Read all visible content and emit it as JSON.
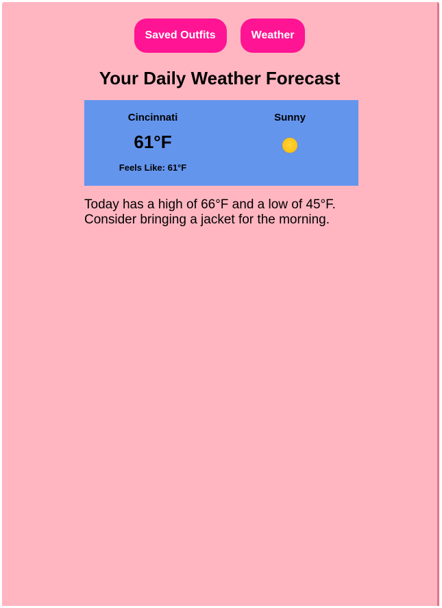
{
  "nav": {
    "saved_outfits_label": "Saved Outfits",
    "weather_label": "Weather"
  },
  "page_title": "Your Daily Weather Forecast",
  "weather_card": {
    "city": "Cincinnati",
    "temperature": "61°F",
    "feels_like": "Feels Like: 61°F",
    "condition": "Sunny",
    "condition_icon": "sun-icon"
  },
  "summary": "Today has a high of 66°F and a low of 45°F. Consider bringing a jacket for the morning.",
  "colors": {
    "background": "#ffb6c1",
    "button": "#ff1493",
    "card": "#6495ed",
    "sun": "#fcc419"
  }
}
